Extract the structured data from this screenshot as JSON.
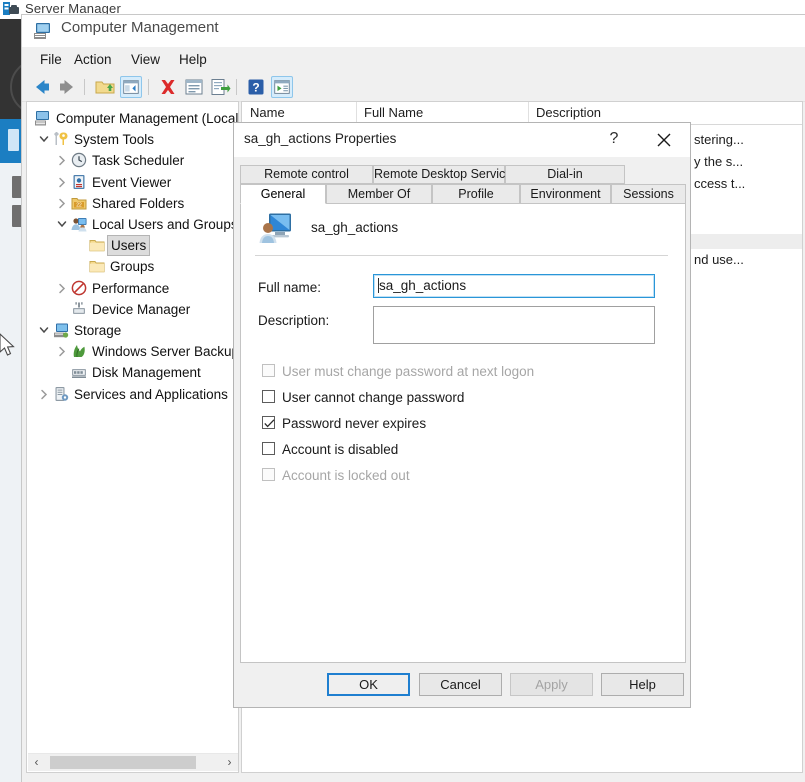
{
  "background": {
    "app_title": "Server Manager",
    "app_icon": "server-manager-icon"
  },
  "cm_window": {
    "title": "Computer Management",
    "title_icon": "computer-management-icon",
    "menu": [
      {
        "label": "File",
        "name": "menu-file"
      },
      {
        "label": "Action",
        "name": "menu-action"
      },
      {
        "label": "View",
        "name": "menu-view"
      },
      {
        "label": "Help",
        "name": "menu-help"
      }
    ],
    "toolbar": [
      {
        "icon": "back-arrow-icon",
        "active": false
      },
      {
        "icon": "forward-arrow-icon",
        "active": false
      },
      {
        "icon": "up-folder-icon",
        "active": false
      },
      {
        "icon": "show-hide-tree-icon",
        "active": true
      },
      {
        "icon": "delete-red-x-icon",
        "active": false
      },
      {
        "icon": "properties-icon",
        "active": false
      },
      {
        "icon": "export-list-icon",
        "active": false
      },
      {
        "icon": "help-question-icon",
        "active": false
      },
      {
        "icon": "show-action-pane-icon",
        "active": true
      }
    ]
  },
  "tree": {
    "items": [
      {
        "label": "Computer Management (Local",
        "icon": "computer-icon",
        "indent": 0,
        "twisty": "none",
        "selected": false
      },
      {
        "label": "System Tools",
        "icon": "system-tools-icon",
        "indent": 1,
        "twisty": "expanded",
        "selected": false
      },
      {
        "label": "Task Scheduler",
        "icon": "clock-icon",
        "indent": 2,
        "twisty": "collapsed",
        "selected": false
      },
      {
        "label": "Event Viewer",
        "icon": "event-viewer-icon",
        "indent": 2,
        "twisty": "collapsed",
        "selected": false
      },
      {
        "label": "Shared Folders",
        "icon": "shared-folders-icon",
        "indent": 2,
        "twisty": "collapsed",
        "selected": false
      },
      {
        "label": "Local Users and Groups",
        "icon": "local-users-groups-icon",
        "indent": 2,
        "twisty": "expanded",
        "selected": false
      },
      {
        "label": "Users",
        "icon": "folder-icon",
        "indent": 3,
        "twisty": "none",
        "selected": true
      },
      {
        "label": "Groups",
        "icon": "folder-icon",
        "indent": 3,
        "twisty": "none",
        "selected": false
      },
      {
        "label": "Performance",
        "icon": "performance-icon",
        "indent": 2,
        "twisty": "collapsed",
        "selected": false
      },
      {
        "label": "Device Manager",
        "icon": "device-manager-icon",
        "indent": 2,
        "twisty": "none",
        "selected": false
      },
      {
        "label": "Storage",
        "icon": "storage-icon",
        "indent": 1,
        "twisty": "expanded",
        "selected": false
      },
      {
        "label": "Windows Server Backup",
        "icon": "windows-server-backup-icon",
        "indent": 2,
        "twisty": "collapsed",
        "selected": false
      },
      {
        "label": "Disk Management",
        "icon": "disk-management-icon",
        "indent": 2,
        "twisty": "none",
        "selected": false
      },
      {
        "label": "Services and Applications",
        "icon": "services-applications-icon",
        "indent": 1,
        "twisty": "collapsed",
        "selected": false
      }
    ],
    "scrollbar": {
      "left_arrow": "‹",
      "right_arrow": "›"
    }
  },
  "list": {
    "columns": [
      "Name",
      "Full Name",
      "Description"
    ],
    "visible_description_fragments": [
      "stering...",
      "y the s...",
      "ccess t...",
      "nd use..."
    ]
  },
  "dialog": {
    "title": "sa_gh_actions Properties",
    "help_glyph": "?",
    "close_icon": "close-x-icon",
    "tabs_top": [
      "Remote control",
      "Remote Desktop Services Profile",
      "Dial-in"
    ],
    "tabs_bottom": [
      "General",
      "Member Of",
      "Profile",
      "Environment",
      "Sessions"
    ],
    "active_tab": "General",
    "user_icon": "user-account-icon",
    "user_name": "sa_gh_actions",
    "fields": [
      {
        "label": "Full name:",
        "value": "sa_gh_actions",
        "placeholder": "",
        "focused": true
      },
      {
        "label": "Description:",
        "value": "",
        "placeholder": "",
        "focused": false
      }
    ],
    "checkboxes": [
      {
        "label": "User must change password at next logon",
        "checked": false,
        "disabled": true
      },
      {
        "label": "User cannot change password",
        "checked": false,
        "disabled": false
      },
      {
        "label": "Password never expires",
        "checked": true,
        "disabled": false
      },
      {
        "label": "Account is disabled",
        "checked": false,
        "disabled": false
      },
      {
        "label": "Account is locked out",
        "checked": false,
        "disabled": true
      }
    ],
    "buttons": [
      {
        "label": "OK",
        "default": true,
        "disabled": false
      },
      {
        "label": "Cancel",
        "default": false,
        "disabled": false
      },
      {
        "label": "Apply",
        "default": false,
        "disabled": true
      },
      {
        "label": "Help",
        "default": false,
        "disabled": false
      }
    ]
  },
  "colors": {
    "accent_blue": "#1f7fd0",
    "focus_blue": "#2a96d8",
    "nav_blue": "#1b7ec2",
    "dialog_bg": "#f0f0f0",
    "selection_grey": "#dcdcdc"
  }
}
